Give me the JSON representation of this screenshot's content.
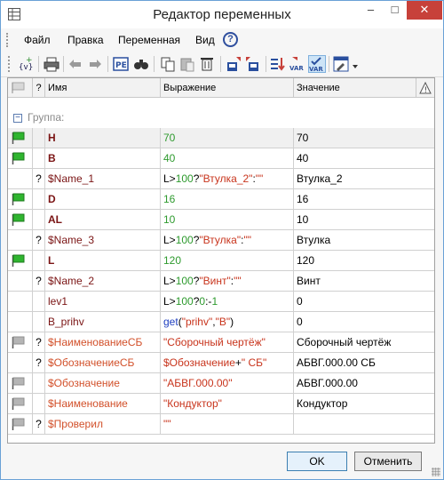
{
  "window": {
    "title": "Редактор переменных",
    "minimize": "–",
    "maximize": "□",
    "close": "✕"
  },
  "menu": {
    "items": [
      "Файл",
      "Правка",
      "Переменная",
      "Вид"
    ],
    "help": "?"
  },
  "toolbar": {
    "icons": [
      "add-variable-icon",
      "print-icon",
      "undo-icon",
      "redo-icon",
      "properties-icon",
      "find-icon",
      "copy-icon",
      "paste-icon",
      "delete-icon",
      "import-icon",
      "export-icon",
      "sort-icon",
      "var-external-icon",
      "var-check-icon",
      "configure-icon"
    ]
  },
  "grid": {
    "headers": {
      "flag": "",
      "q": "?",
      "name": "Имя",
      "expr": "Выражение",
      "value": "Значение",
      "warn": "!"
    },
    "group_toggle": "−",
    "group_label": "Группа:",
    "rows": [
      {
        "flag": "green",
        "q": "",
        "name": "H",
        "expr": "70",
        "value": "70",
        "name_style": "bold",
        "expr_color": "#2e9a2e"
      },
      {
        "flag": "green",
        "q": "",
        "name": "B",
        "expr": "40",
        "value": "40",
        "name_style": "bold",
        "expr_color": "#2e9a2e"
      },
      {
        "flag": "",
        "q": "?",
        "name": "$Name_1",
        "expr": "L>100?\"Втулка_2\":\"\"",
        "value": "Втулка_2",
        "name_style": "normal"
      },
      {
        "flag": "green",
        "q": "",
        "name": "D",
        "expr": "16",
        "value": "16",
        "name_style": "bold",
        "expr_color": "#2e9a2e"
      },
      {
        "flag": "green",
        "q": "",
        "name": "AL",
        "expr": "10",
        "value": "10",
        "name_style": "bold",
        "expr_color": "#2e9a2e"
      },
      {
        "flag": "",
        "q": "?",
        "name": "$Name_3",
        "expr": "L>100?\"Втулка\":\"\"",
        "value": "Втулка",
        "name_style": "normal"
      },
      {
        "flag": "green",
        "q": "",
        "name": "L",
        "expr": "120",
        "value": "120",
        "name_style": "bold",
        "expr_color": "#2e9a2e"
      },
      {
        "flag": "",
        "q": "?",
        "name": "$Name_2",
        "expr": "L>100?\"Винт\":\"\"",
        "value": "Винт",
        "name_style": "normal"
      },
      {
        "flag": "",
        "q": "",
        "name": "lev1",
        "expr": "L>100?0:-1",
        "value": "0",
        "name_style": "normal"
      },
      {
        "flag": "",
        "q": "",
        "name": "B_prihv",
        "expr": "get(\"prihv\",\"B\")",
        "value": "0",
        "name_style": "normal"
      },
      {
        "flag": "grey",
        "q": "?",
        "name": "$НаименованиеСБ",
        "expr": "\"Сборочный чертёж\"",
        "value": "Сборочный чертёж",
        "name_style": "red"
      },
      {
        "flag": "",
        "q": "?",
        "name": "$ОбозначениеСБ",
        "expr": "$Обозначение+\" СБ\"",
        "value": "АБВГ.000.00 СБ",
        "name_style": "red"
      },
      {
        "flag": "grey",
        "q": "",
        "name": "$Обозначение",
        "expr": "\"АБВГ.000.00\"",
        "value": "АБВГ.000.00",
        "name_style": "red"
      },
      {
        "flag": "grey",
        "q": "",
        "name": "$Наименование",
        "expr": "\"Кондуктор\"",
        "value": "Кондуктор",
        "name_style": "red"
      },
      {
        "flag": "grey",
        "q": "?",
        "name": "$Проверил",
        "expr": "\"\"",
        "value": "",
        "name_style": "red"
      }
    ]
  },
  "buttons": {
    "ok": "OK",
    "cancel": "Отменить"
  },
  "colors": {
    "name_bold": "#7a1414",
    "name_red": "#d2502a",
    "number_green": "#2e9a2e",
    "string_red": "#c8341c",
    "keyword_blue": "#2040c0",
    "flag_green": "#2fb52f",
    "flag_grey": "#b5b5b5"
  }
}
